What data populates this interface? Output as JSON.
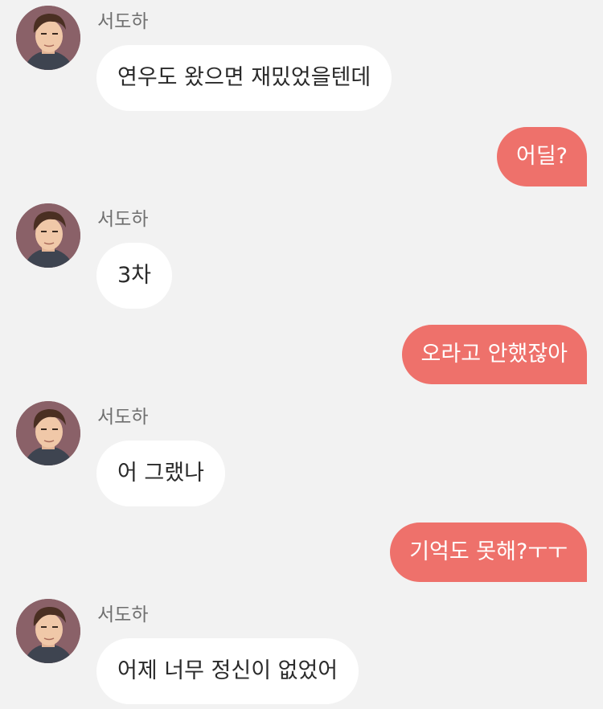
{
  "colors": {
    "background": "#f2f2f2",
    "incoming_bubble": "#ffffff",
    "outgoing_bubble": "#ee716b",
    "sender_name": "#6f6f6f"
  },
  "messages": [
    {
      "direction": "incoming",
      "sender": "서도하",
      "text": "연우도 왔으면 재밌었을텐데",
      "avatar_icon": "person-avatar-icon"
    },
    {
      "direction": "outgoing",
      "text": "어딜?"
    },
    {
      "direction": "incoming",
      "sender": "서도하",
      "text": "3차",
      "avatar_icon": "person-avatar-icon"
    },
    {
      "direction": "outgoing",
      "text": "오라고 안했잖아"
    },
    {
      "direction": "incoming",
      "sender": "서도하",
      "text": "어 그랬나",
      "avatar_icon": "person-avatar-icon"
    },
    {
      "direction": "outgoing",
      "text": "기억도 못해?ㅜㅜ"
    },
    {
      "direction": "incoming",
      "sender": "서도하",
      "text": "어제 너무 정신이 없었어",
      "avatar_icon": "person-avatar-icon"
    }
  ]
}
